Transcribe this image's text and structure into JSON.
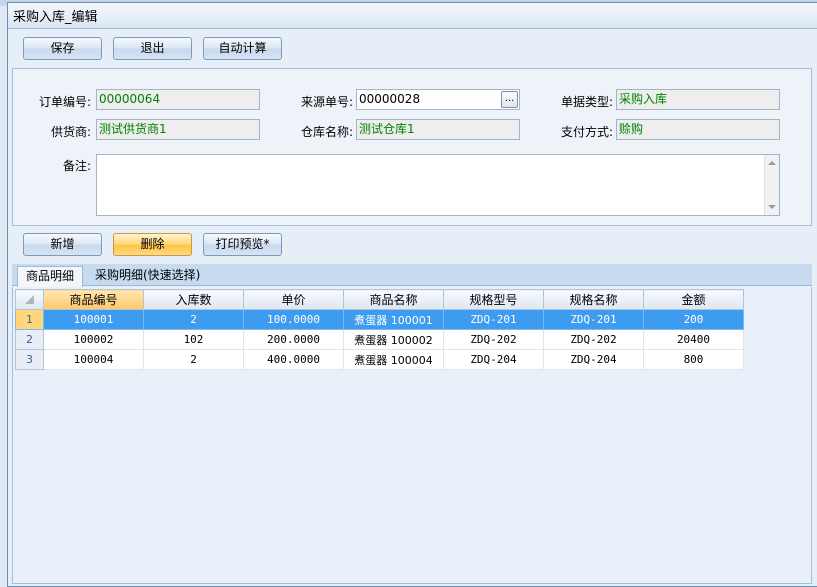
{
  "window": {
    "title": "采购入库_编辑"
  },
  "toolbar": {
    "save_label": "保存",
    "exit_label": "退出",
    "auto_calc_label": "自动计算"
  },
  "form": {
    "order_no": {
      "label": "订单编号:",
      "value": "00000064"
    },
    "source_no": {
      "label": "来源单号:",
      "value": "00000028",
      "button": "..."
    },
    "doc_type": {
      "label": "单据类型:",
      "value": "采购入库"
    },
    "supplier": {
      "label": "供货商:",
      "value": "测试供货商1"
    },
    "warehouse": {
      "label": "仓库名称:",
      "value": "测试仓库1"
    },
    "payment": {
      "label": "支付方式:",
      "value": "赊购"
    },
    "remark": {
      "label": "备注:",
      "value": ""
    }
  },
  "detail_toolbar": {
    "add_label": "新增",
    "delete_label": "删除",
    "print_label": "打印预览*"
  },
  "tabs": [
    {
      "label": "商品明细"
    },
    {
      "label": "采购明细(快速选择)"
    }
  ],
  "grid": {
    "columns": [
      "商品编号",
      "入库数",
      "单价",
      "商品名称",
      "规格型号",
      "规格名称",
      "金额"
    ],
    "rows": [
      {
        "index": "1",
        "cells": [
          "100001",
          "2",
          "100.0000",
          "煮蛋器 100001",
          "ZDQ-201",
          "ZDQ-201",
          "200"
        ]
      },
      {
        "index": "2",
        "cells": [
          "100002",
          "102",
          "200.0000",
          "煮蛋器 100002",
          "ZDQ-202",
          "ZDQ-202",
          "20400"
        ]
      },
      {
        "index": "3",
        "cells": [
          "100004",
          "2",
          "400.0000",
          "煮蛋器 100004",
          "ZDQ-204",
          "ZDQ-204",
          "800"
        ]
      }
    ]
  },
  "colors": {
    "selected_row": "#3d9bf0",
    "readonly_text": "#008000",
    "highlight_button": "#ffc53d"
  }
}
